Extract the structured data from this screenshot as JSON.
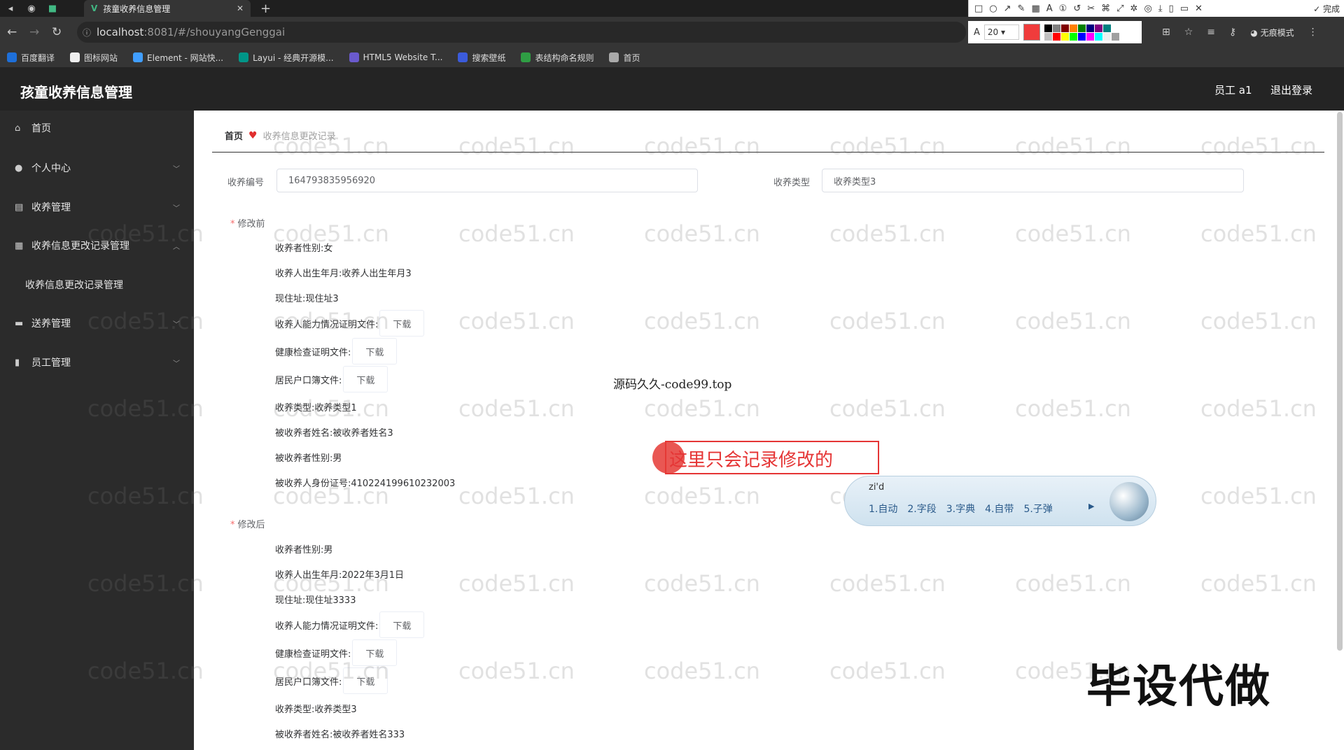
{
  "browser": {
    "tab_title": "孩童收养信息管理",
    "url_host": "localhost",
    "url_rest": ":8081/#/shouyangGenggai",
    "font_size": "20",
    "incognito": "无痕模式",
    "done": "完成",
    "bookmarks": [
      {
        "label": "百度翻译",
        "color": "#1e6fd9"
      },
      {
        "label": "图标网站",
        "color": "#eeeeee"
      },
      {
        "label": "Element - 网站快...",
        "color": "#409eff"
      },
      {
        "label": "Layui - 经典开源模...",
        "color": "#009688"
      },
      {
        "label": "HTML5 Website T...",
        "color": "#6a5acd"
      },
      {
        "label": "搜索壁纸",
        "color": "#3b5bdb"
      },
      {
        "label": "表结构命名规则",
        "color": "#2f9e44"
      },
      {
        "label": "首页",
        "color": "#aaaaaa"
      }
    ],
    "palette": [
      "#000000",
      "#808080",
      "#800000",
      "#ff8000",
      "#008000",
      "#000080",
      "#800080",
      "#008080",
      "#ffffff",
      "#c0c0c0",
      "#ff0000",
      "#ffff00",
      "#00ff00",
      "#0000ff",
      "#ff00ff",
      "#00ffff",
      "#f0f0f0",
      "#a0a0a0"
    ]
  },
  "header": {
    "title": "孩童收养信息管理",
    "user": "员工 a1",
    "logout": "退出登录"
  },
  "sidebar": {
    "items": [
      {
        "label": "首页",
        "icon": "home-icon"
      },
      {
        "label": "个人中心",
        "icon": "user-icon"
      },
      {
        "label": "收养管理",
        "icon": "list-icon"
      },
      {
        "label": "收养信息更改记录管理",
        "icon": "grid-icon"
      },
      {
        "label": "收养信息更改记录管理"
      },
      {
        "label": "送养管理",
        "icon": "folder-icon"
      },
      {
        "label": "员工管理",
        "icon": "chart-icon"
      }
    ]
  },
  "breadcrumb": {
    "home": "首页",
    "current": "收养信息更改记录"
  },
  "form": {
    "adoption_no_label": "收养编号",
    "adoption_no": "164793835956920",
    "adoption_type_label": "收养类型",
    "adoption_type": "收养类型3",
    "before_label": "修改前",
    "after_label": "修改后",
    "download": "下载",
    "before": {
      "gender": "收养者性别:女",
      "birth": "收养人出生年月:收养人出生年月3",
      "address": "现住址:现住址3",
      "ability_file": "收养人能力情况证明文件:",
      "health_file": "健康检查证明文件:",
      "household_file": "居民户口簿文件:",
      "type": "收养类型:收养类型1",
      "adoptee_name": "被收养者姓名:被收养者姓名3",
      "adoptee_gender": "被收养者性别:男",
      "adoptee_id": "被收养人身份证号:410224199610232003"
    },
    "after": {
      "gender": "收养者性别:男",
      "birth": "收养人出生年月:2022年3月1日",
      "address": "现住址:现住址3333",
      "ability_file": "收养人能力情况证明文件:",
      "health_file": "健康检查证明文件:",
      "household_file": "居民户口簿文件:",
      "type": "收养类型:收养类型3",
      "adoptee_name": "被收养者姓名:被收养者姓名333"
    }
  },
  "overlay": {
    "source_note": "源码久久-code99.top",
    "annotation": "这里只会记录修改的",
    "ime_pinyin": "zi'd",
    "ime_candidates": [
      "1.自动",
      "2.字段",
      "3.字典",
      "4.自带",
      "5.子弹"
    ],
    "stamp": "毕设代做",
    "watermark": "code51.cn"
  }
}
